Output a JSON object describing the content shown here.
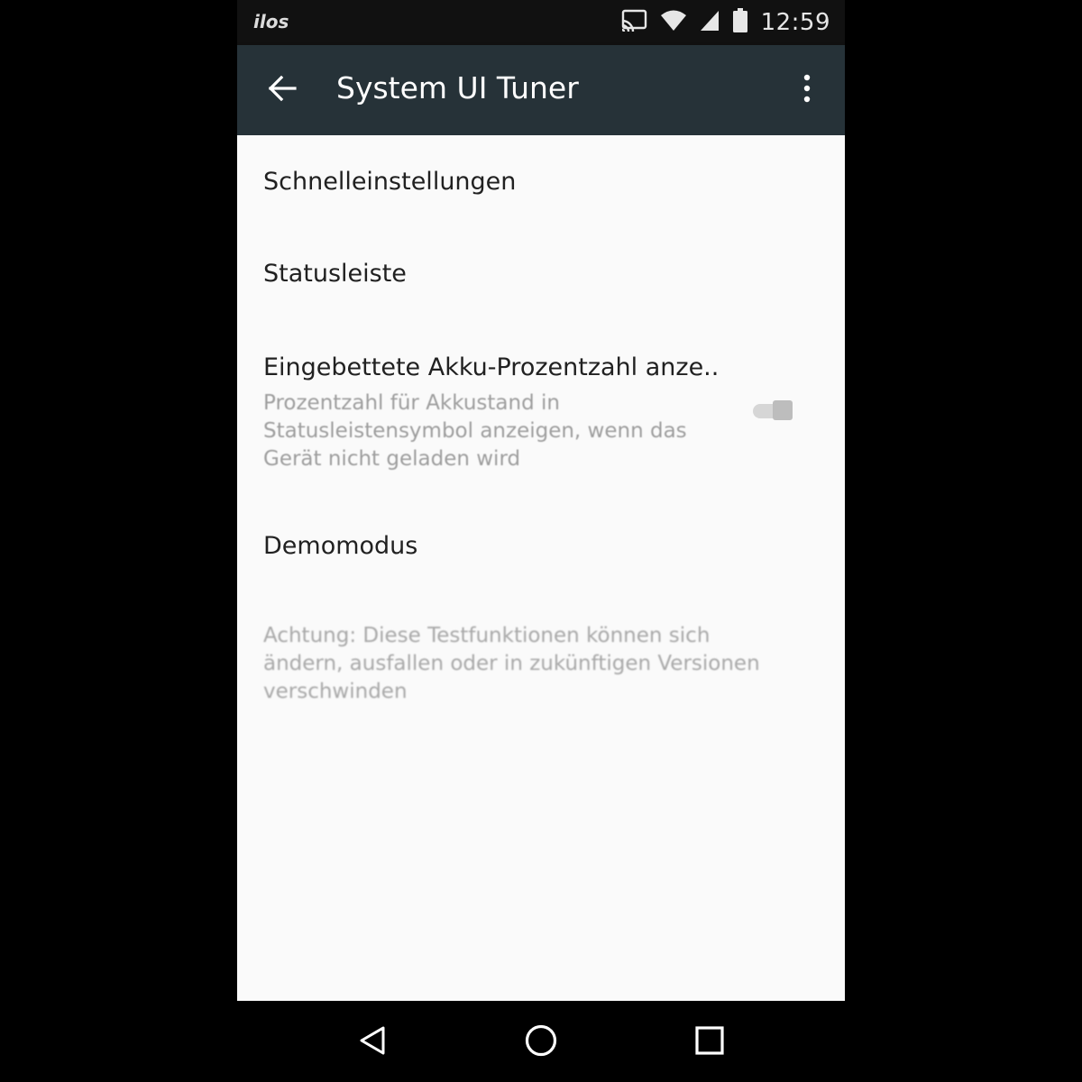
{
  "status_bar": {
    "carrier_icon_label": "ilos",
    "icons": [
      "cast-icon",
      "wifi-icon",
      "signal-icon",
      "battery-icon"
    ],
    "time": "12:59"
  },
  "app_bar": {
    "title": "System UI Tuner",
    "back_icon": "arrow-back-icon",
    "overflow_icon": "more-vert-icon",
    "background": "#263238"
  },
  "preferences": [
    {
      "title": "Schnelleinstellungen"
    },
    {
      "title": "Statusleiste"
    },
    {
      "title": "Eingebettete Akku-Prozentzahl anze..",
      "summary": "Prozentzahl für Akkustand in Statusleistensymbol anzeigen, wenn das Gerät nicht geladen wird",
      "switch_checked": false
    },
    {
      "title": "Demomodus"
    }
  ],
  "footer_note": "Achtung: Diese Testfunktionen können sich ändern, ausfallen oder in zukünftigen Versionen verschwinden",
  "nav_bar": {
    "icons": [
      "back-triangle-icon",
      "home-circle-icon",
      "recents-square-icon"
    ]
  }
}
